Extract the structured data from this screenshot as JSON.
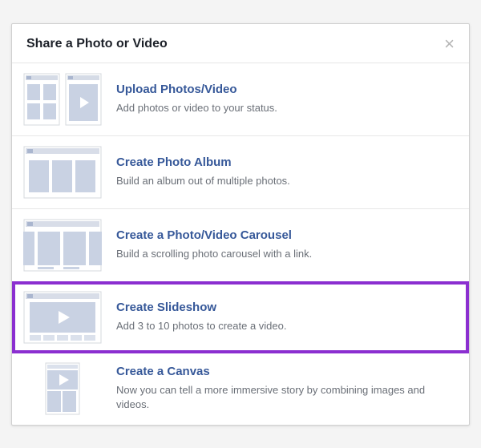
{
  "dialog": {
    "title": "Share a Photo or Video",
    "close_glyph": "×"
  },
  "options": [
    {
      "title": "Upload Photos/Video",
      "desc": "Add photos or video to your status."
    },
    {
      "title": "Create Photo Album",
      "desc": "Build an album out of multiple photos."
    },
    {
      "title": "Create a Photo/Video Carousel",
      "desc": "Build a scrolling photo carousel with a link."
    },
    {
      "title": "Create Slideshow",
      "desc": "Add 3 to 10 photos to create a video."
    },
    {
      "title": "Create a Canvas",
      "desc": "Now you can tell a more immersive story by combining images and videos."
    }
  ]
}
